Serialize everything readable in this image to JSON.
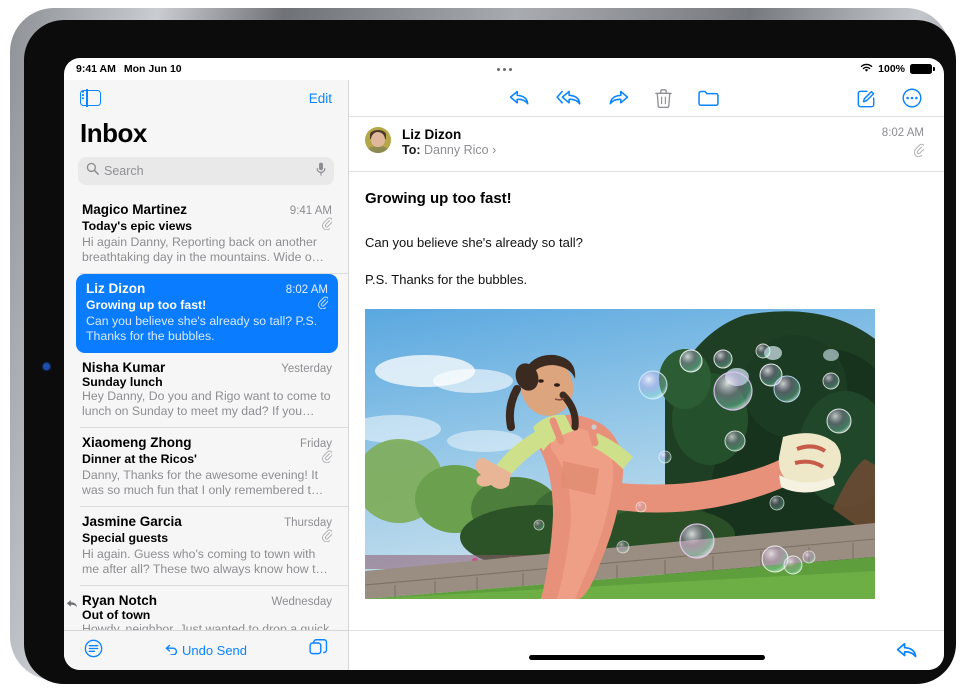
{
  "status_bar": {
    "time": "9:41 AM",
    "date": "Mon Jun 10",
    "wifi_icon": "wifi-icon",
    "battery_percent": "100%",
    "battery_icon": "battery-full-icon",
    "multitasking_icon": "multitasking-dots-icon"
  },
  "sidebar": {
    "toggle_icon": "sidebar-toggle-icon",
    "edit_label": "Edit",
    "title": "Inbox",
    "search": {
      "placeholder": "Search",
      "value": "",
      "search_icon": "search-icon",
      "dictation_icon": "microphone-icon"
    },
    "messages": [
      {
        "sender": "Magico Martinez",
        "date": "9:41 AM",
        "subject": "Today's epic views",
        "preview": "Hi again Danny, Reporting back on another breathtaking day in the mountains. Wide o…",
        "has_attachment": true,
        "replied": false,
        "selected": false
      },
      {
        "sender": "Liz Dizon",
        "date": "8:02 AM",
        "subject": "Growing up too fast!",
        "preview": "Can you believe she's already so tall? P.S. Thanks for the bubbles.",
        "has_attachment": true,
        "replied": false,
        "selected": true
      },
      {
        "sender": "Nisha Kumar",
        "date": "Yesterday",
        "subject": "Sunday lunch",
        "preview": "Hey Danny, Do you and Rigo want to come to lunch on Sunday to meet my dad? If you…",
        "has_attachment": false,
        "replied": false,
        "selected": false
      },
      {
        "sender": "Xiaomeng Zhong",
        "date": "Friday",
        "subject": "Dinner at the Ricos'",
        "preview": "Danny, Thanks for the awesome evening! It was so much fun that I only remembered t…",
        "has_attachment": true,
        "replied": false,
        "selected": false
      },
      {
        "sender": "Jasmine Garcia",
        "date": "Thursday",
        "subject": "Special guests",
        "preview": "Hi again. Guess who's coming to town with me after all? These two always know how t…",
        "has_attachment": true,
        "replied": false,
        "selected": false
      },
      {
        "sender": "Ryan Notch",
        "date": "Wednesday",
        "subject": "Out of town",
        "preview": "Howdy, neighbor, Just wanted to drop a quick note to let you know we're leaving T…",
        "has_attachment": false,
        "replied": true,
        "selected": false
      }
    ],
    "bottom_bar": {
      "filter_icon": "filter-icon",
      "undo_send_label": "Undo Send",
      "undo_icon": "undo-arrow-icon",
      "new_window_icon": "new-window-icon"
    }
  },
  "detail": {
    "toolbar": {
      "reply_icon": "reply-icon",
      "reply_all_icon": "reply-all-icon",
      "forward_icon": "forward-icon",
      "trash_icon": "trash-icon",
      "move_icon": "folder-icon",
      "compose_icon": "compose-icon",
      "more_icon": "more-ellipsis-icon"
    },
    "message": {
      "sender": "Liz Dizon",
      "to_label": "To:",
      "to_recipient": "Danny Rico",
      "disclosure_icon": "chevron-right-icon",
      "time": "8:02 AM",
      "attachment_icon": "paperclip-icon",
      "subject": "Growing up too fast!",
      "paragraphs": [
        "Can you believe she's already so tall?",
        "P.S. Thanks for the bubbles."
      ],
      "photo_alt": "girl-kicking-with-bubbles-photo"
    },
    "bottom_bar": {
      "reply_icon": "reply-icon"
    }
  },
  "colors": {
    "accent": "#0a84ff",
    "selected_row": "#0a7cff",
    "secondary_text": "#8e8e93",
    "sidebar_bg": "#f6f6f6"
  },
  "home_indicator": "home-indicator"
}
